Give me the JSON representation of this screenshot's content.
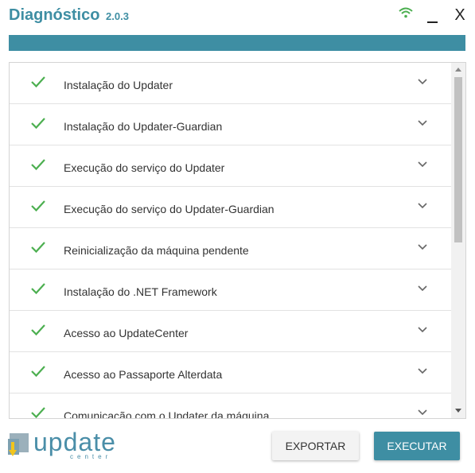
{
  "window": {
    "title": "Diagnóstico",
    "version": "2.0.3",
    "close_label": "X"
  },
  "progress": {
    "fraction": 1.0
  },
  "checks": [
    {
      "label": "Instalação do Updater",
      "status": "ok"
    },
    {
      "label": "Instalação do Updater-Guardian",
      "status": "ok"
    },
    {
      "label": "Execução do serviço do Updater",
      "status": "ok"
    },
    {
      "label": "Execução do serviço do Updater-Guardian",
      "status": "ok"
    },
    {
      "label": "Reinicialização da máquina pendente",
      "status": "ok"
    },
    {
      "label": "Instalação do .NET Framework",
      "status": "ok"
    },
    {
      "label": "Acesso ao UpdateCenter",
      "status": "ok"
    },
    {
      "label": "Acesso ao Passaporte Alterdata",
      "status": "ok"
    },
    {
      "label": "Comunicação com o Updater da máquina",
      "status": "ok"
    }
  ],
  "logo": {
    "word": "update",
    "sub": "center"
  },
  "buttons": {
    "export": "EXPORTAR",
    "run": "EXECUTAR"
  },
  "colors": {
    "accent": "#3e8ea3",
    "check": "#4caf50",
    "wifi": "#4caf50"
  }
}
